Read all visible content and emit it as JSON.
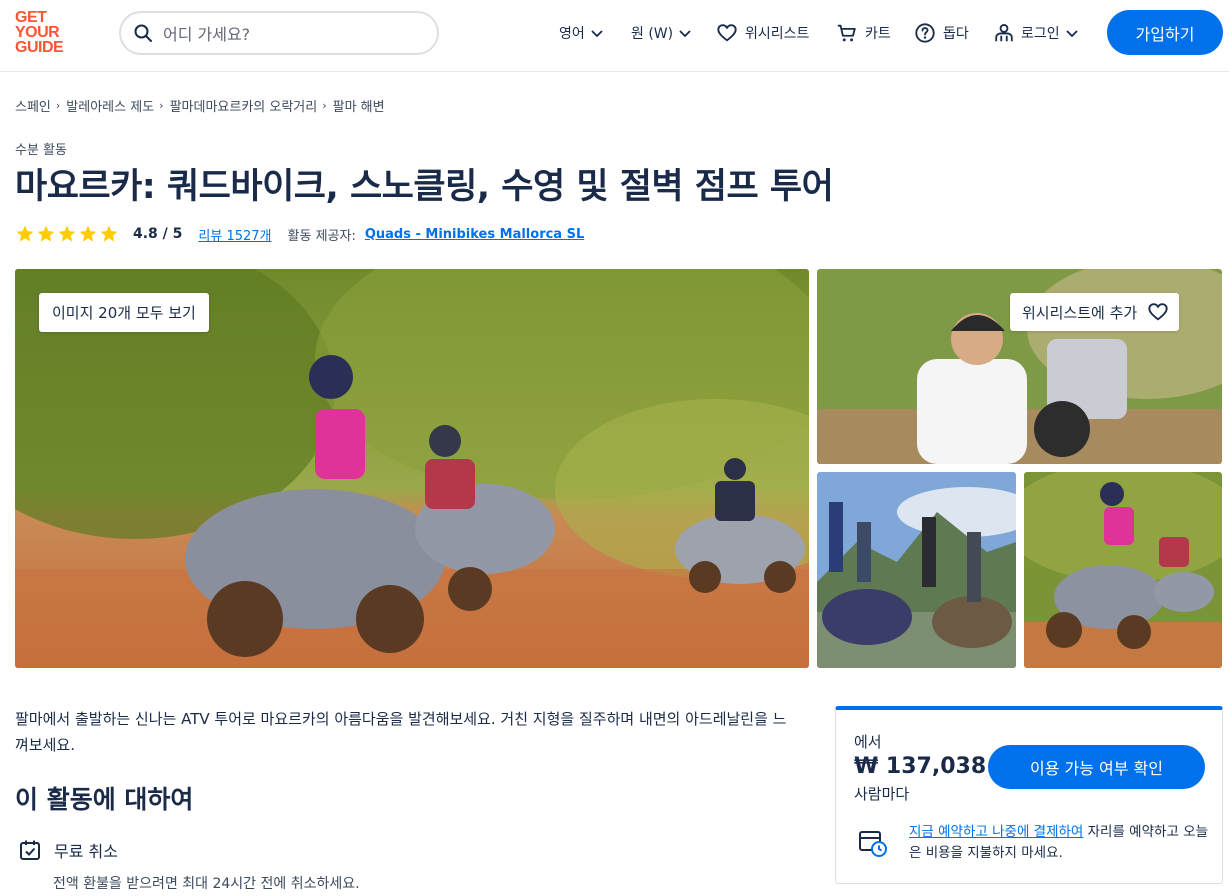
{
  "header": {
    "logo": [
      "GET",
      "YOUR",
      "GUIDE"
    ],
    "search_placeholder": "어디 가세요?",
    "language": "영어",
    "currency": "원 (W)",
    "wishlist": "위시리스트",
    "cart": "카트",
    "help": "돕다",
    "login": "로그인",
    "signup": "가입하기"
  },
  "breadcrumb": [
    "스페인",
    "발레아레스 제도",
    "팔마데마요르카의 오락거리",
    "팔마 해변"
  ],
  "activity": {
    "category": "수분 활동",
    "title": "마요르카: 쿼드바이크, 스노클링, 수영 및 절벽 점프 투어",
    "rating": "4.8 / 5",
    "stars": 5,
    "reviews": "리뷰 1527개",
    "provider_label": "활동 제공자:",
    "provider": "Quads - Minibikes Mallorca SL"
  },
  "gallery": {
    "view_all": "이미지 20개 모두 보기",
    "add_wishlist": "위시리스트에 추가"
  },
  "description": "팔마에서 출발하는 신나는 ATV 투어로 마요르카의 아름다움을 발견해보세요. 거친 지형을 질주하며 내면의 아드레날린을 느껴보세요.",
  "about": {
    "heading": "이 활동에 대하여",
    "features": [
      {
        "title": "무료 취소",
        "subtitle": "전액 환불을 받으려면 최대 24시간 전에 취소하세요."
      }
    ]
  },
  "booking": {
    "from": "에서",
    "price": "₩ 137,038",
    "per": "사람마다",
    "check_button": "이용 가능 여부 확인",
    "rnpl_link": "지금 예약하고 나중에 결제하여",
    "rnpl_text": " 자리를 예약하고 오늘은 비용을 지불하지 마세요."
  },
  "colors": {
    "brand_orange": "#ff5533",
    "primary_blue": "#0071eb",
    "star_yellow": "#ffcc00",
    "text_dark": "#1a2b49"
  }
}
